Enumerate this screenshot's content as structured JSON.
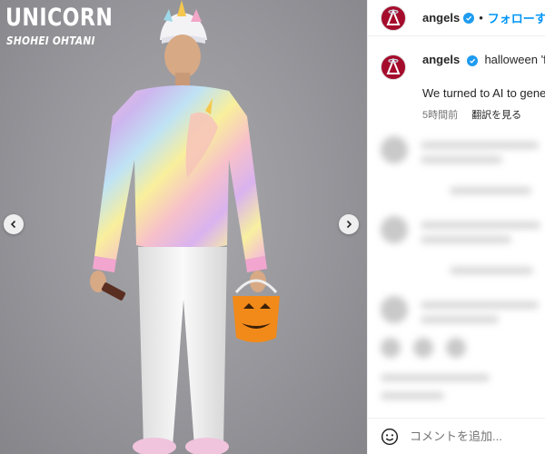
{
  "photo": {
    "title": "UNICORN",
    "subtitle": "SHOHEI OHTANI"
  },
  "carousel": {
    "prev_icon": "chevron-left-icon",
    "next_icon": "chevron-right-icon"
  },
  "post": {
    "username": "angels",
    "follow_label": "フォローする",
    "separator": "•",
    "caption_text": "halloween 'fit c",
    "caption_line2": "We turned to AI to gene",
    "timestamp": "5時間前",
    "translate_label": "翻訳を見る"
  },
  "comment_box": {
    "emoji_icon": "smiley-icon",
    "placeholder": "コメントを追加..."
  },
  "colors": {
    "brand_red": "#a50c2c",
    "link_blue": "#0095f6",
    "verified_blue": "#1d9bf0"
  }
}
